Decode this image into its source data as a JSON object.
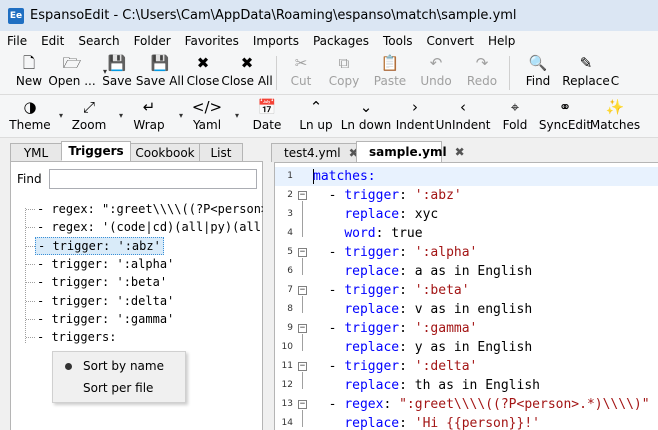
{
  "window": {
    "app_icon": "Ee",
    "title": "EspansoEdit - C:\\Users\\Cam\\AppData\\Roaming\\espanso\\match\\sample.yml"
  },
  "menu": [
    "File",
    "Edit",
    "Search",
    "Folder",
    "Favorites",
    "Imports",
    "Packages",
    "Tools",
    "Convert",
    "Help"
  ],
  "toolbar1": [
    {
      "label": "New",
      "icon": "new-file-icon",
      "glyph": "🗋",
      "disabled": false
    },
    {
      "label": "Open ...",
      "icon": "open-folder-icon",
      "glyph": "🗁",
      "disabled": false,
      "dropdown": true
    },
    {
      "label": "Save",
      "icon": "save-icon",
      "glyph": "💾",
      "disabled": false
    },
    {
      "label": "Save All",
      "icon": "save-all-icon",
      "glyph": "💾",
      "disabled": false
    },
    {
      "label": "Close",
      "icon": "close-icon",
      "glyph": "✖",
      "disabled": false
    },
    {
      "label": "Close All",
      "icon": "close-all-icon",
      "glyph": "✖",
      "disabled": false
    },
    {
      "label": "Cut",
      "icon": "cut-icon",
      "glyph": "✂",
      "disabled": true
    },
    {
      "label": "Copy",
      "icon": "copy-icon",
      "glyph": "⧉",
      "disabled": true
    },
    {
      "label": "Paste",
      "icon": "paste-icon",
      "glyph": "📋",
      "disabled": true
    },
    {
      "label": "Undo",
      "icon": "undo-icon",
      "glyph": "↶",
      "disabled": true
    },
    {
      "label": "Redo",
      "icon": "redo-icon",
      "glyph": "↷",
      "disabled": true
    },
    {
      "label": "Find",
      "icon": "search-icon",
      "glyph": "🔍",
      "disabled": false
    },
    {
      "label": "Replace",
      "icon": "replace-icon",
      "glyph": "✎",
      "disabled": false
    },
    {
      "label": "C",
      "icon": "clipped-icon",
      "glyph": "",
      "disabled": false
    }
  ],
  "toolbar2": [
    {
      "label": "Theme",
      "icon": "theme-icon",
      "glyph": "◑",
      "dropdown": true
    },
    {
      "label": "Zoom",
      "icon": "zoom-icon",
      "glyph": "⤢",
      "dropdown": true
    },
    {
      "label": "Wrap",
      "icon": "wrap-icon",
      "glyph": "↵",
      "dropdown": true
    },
    {
      "label": "Yaml",
      "icon": "yaml-icon",
      "glyph": "</>",
      "dropdown": true
    },
    {
      "label": "Date",
      "icon": "calendar-icon",
      "glyph": "📅"
    },
    {
      "label": "Ln up",
      "icon": "chevron-up-icon",
      "glyph": "⌃"
    },
    {
      "label": "Ln down",
      "icon": "chevron-down-icon",
      "glyph": "⌄"
    },
    {
      "label": "Indent",
      "icon": "indent-icon",
      "glyph": "›"
    },
    {
      "label": "UnIndent",
      "icon": "unindent-icon",
      "glyph": "‹"
    },
    {
      "label": "Fold",
      "icon": "fold-icon",
      "glyph": "⌖"
    },
    {
      "label": "SyncEdit",
      "icon": "syncedit-icon",
      "glyph": "⚭"
    },
    {
      "label": "Matches",
      "icon": "matches-icon",
      "glyph": "✨"
    }
  ],
  "left_tabs": [
    "YML",
    "Triggers",
    "Cookbook",
    "List"
  ],
  "left_active_tab": "Triggers",
  "find": {
    "label": "Find",
    "value": ""
  },
  "tree": [
    "- regex: \":greet\\\\\\\\((?P<person>",
    "- regex: '(code|cd)(all|py)(all|",
    "- trigger: ':abz'",
    "- trigger: ':alpha'",
    "- trigger: ':beta'",
    "- trigger: ':delta'",
    "- trigger: ':gamma'",
    "- triggers:"
  ],
  "tree_selected_index": 2,
  "context_menu": {
    "items": [
      "Sort by name",
      "Sort per file"
    ],
    "checked_index": 0
  },
  "editor_tabs": [
    {
      "label": "test4.yml",
      "active": false
    },
    {
      "label": "sample.yml",
      "active": true
    }
  ],
  "code_lines": [
    {
      "num": "1",
      "fold": false,
      "parts": [
        [
          "k",
          "matches:"
        ]
      ]
    },
    {
      "num": "2",
      "fold": true,
      "parts": [
        [
          "t",
          "  - "
        ],
        [
          "k",
          "trigger"
        ],
        [
          "t",
          ": "
        ],
        [
          "s",
          "':abz'"
        ]
      ]
    },
    {
      "num": "3",
      "fold": false,
      "parts": [
        [
          "t",
          "    "
        ],
        [
          "k",
          "replace"
        ],
        [
          "t",
          ": xyc"
        ]
      ]
    },
    {
      "num": "4",
      "fold": false,
      "parts": [
        [
          "t",
          "    "
        ],
        [
          "k",
          "word"
        ],
        [
          "t",
          ": true"
        ]
      ]
    },
    {
      "num": "5",
      "fold": true,
      "parts": [
        [
          "t",
          "  - "
        ],
        [
          "k",
          "trigger"
        ],
        [
          "t",
          ": "
        ],
        [
          "s",
          "':alpha'"
        ]
      ]
    },
    {
      "num": "6",
      "fold": false,
      "parts": [
        [
          "t",
          "    "
        ],
        [
          "k",
          "replace"
        ],
        [
          "t",
          ": a as in English"
        ]
      ]
    },
    {
      "num": "7",
      "fold": true,
      "parts": [
        [
          "t",
          "  - "
        ],
        [
          "k",
          "trigger"
        ],
        [
          "t",
          ": "
        ],
        [
          "s",
          "':beta'"
        ]
      ]
    },
    {
      "num": "8",
      "fold": false,
      "parts": [
        [
          "t",
          "    "
        ],
        [
          "k",
          "replace"
        ],
        [
          "t",
          ": v as in english"
        ]
      ]
    },
    {
      "num": "9",
      "fold": true,
      "parts": [
        [
          "t",
          "  - "
        ],
        [
          "k",
          "trigger"
        ],
        [
          "t",
          ": "
        ],
        [
          "s",
          "':gamma'"
        ]
      ]
    },
    {
      "num": "10",
      "fold": false,
      "parts": [
        [
          "t",
          "    "
        ],
        [
          "k",
          "replace"
        ],
        [
          "t",
          ": y as in English"
        ]
      ]
    },
    {
      "num": "11",
      "fold": true,
      "parts": [
        [
          "t",
          "  - "
        ],
        [
          "k",
          "trigger"
        ],
        [
          "t",
          ": "
        ],
        [
          "s",
          "':delta'"
        ]
      ]
    },
    {
      "num": "12",
      "fold": false,
      "parts": [
        [
          "t",
          "    "
        ],
        [
          "k",
          "replace"
        ],
        [
          "t",
          ": th as in English"
        ]
      ]
    },
    {
      "num": "13",
      "fold": true,
      "parts": [
        [
          "t",
          "  - "
        ],
        [
          "k",
          "regex"
        ],
        [
          "t",
          ": "
        ],
        [
          "s",
          "\":greet\\\\\\\\((?P<person>.*)\\\\\\\\)\""
        ]
      ]
    },
    {
      "num": "14",
      "fold": false,
      "parts": [
        [
          "t",
          "    "
        ],
        [
          "k",
          "replace"
        ],
        [
          "t",
          ": "
        ],
        [
          "s",
          "'Hi {{person}}!'"
        ]
      ]
    }
  ],
  "colors": {
    "keyword": "#0000ff",
    "string": "#a31515",
    "current_line": "#e8f2fe",
    "selection": "#d9ebf9"
  }
}
